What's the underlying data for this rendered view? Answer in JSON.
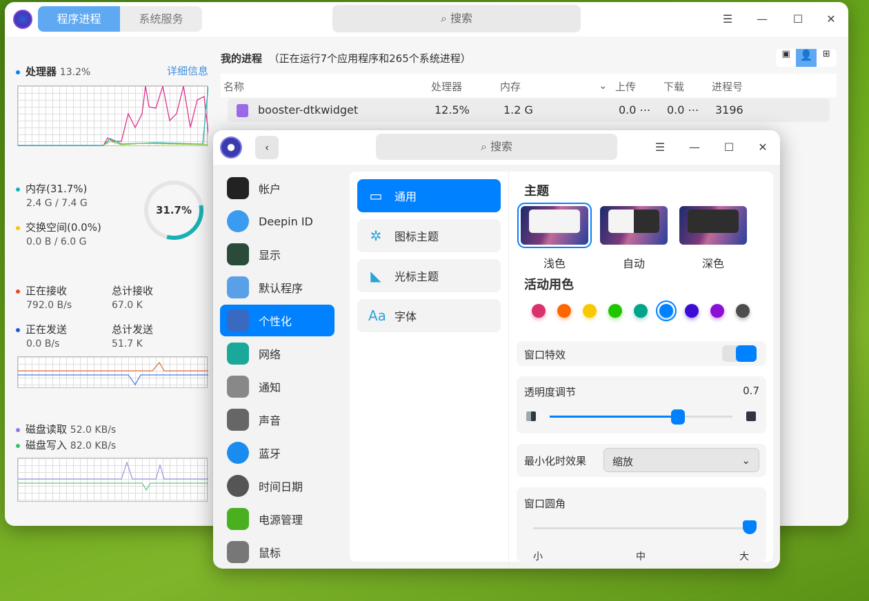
{
  "monitor": {
    "tabs": [
      "程序进程",
      "系统服务"
    ],
    "search": "搜索",
    "cpu": {
      "label": "处理器",
      "value": "13.2%",
      "detail": "详细信息"
    },
    "memory": {
      "label": "内存(31.7%)",
      "usage": "2.4 G / 7.4 G",
      "percent_text": "31.7%",
      "percent": 31.7
    },
    "swap": {
      "label": "交换空间(0.0%)",
      "usage": "0.0 B / 6.0 G"
    },
    "net": {
      "recv_label": "正在接收",
      "recv": "792.0 B/s",
      "total_recv_label": "总计接收",
      "total_recv": "67.0 K",
      "send_label": "正在发送",
      "send": "0.0 B/s",
      "total_send_label": "总计发送",
      "total_send": "51.7 K"
    },
    "disk": {
      "read_label": "磁盘读取",
      "read": "52.0 KB/s",
      "write_label": "磁盘写入",
      "write": "82.0 KB/s"
    },
    "proc_title": "我的进程",
    "proc_sub": "（正在运行7个应用程序和265个系统进程）",
    "columns": [
      "名称",
      "处理器",
      "内存",
      "上传",
      "下载",
      "进程号"
    ],
    "rows": [
      {
        "name": "booster-dtkwidget",
        "cpu": "12.5%",
        "mem": "1.2 G",
        "up": "0.0 ⋯",
        "down": "0.0 ⋯",
        "pid": "3196"
      }
    ]
  },
  "settings": {
    "search": "搜索",
    "nav": [
      "帐户",
      "Deepin ID",
      "显示",
      "默认程序",
      "个性化",
      "网络",
      "通知",
      "声音",
      "蓝牙",
      "时间日期",
      "电源管理",
      "鼠标"
    ],
    "sub": [
      "通用",
      "图标主题",
      "光标主题",
      "字体"
    ],
    "theme_title": "主题",
    "themes": [
      "浅色",
      "自动",
      "深色"
    ],
    "accent_title": "活动用色",
    "accent_colors": [
      "#d8326c",
      "#ff6600",
      "#f9c900",
      "#22c400",
      "#00a48a",
      "#0081ff",
      "#3d0ad6",
      "#8c0fd6",
      "#4d4d4d"
    ],
    "accent_selected": "#0081ff",
    "window_effect": "窗口特效",
    "window_effect_on": true,
    "opacity_label": "透明度调节",
    "opacity_value": "0.7",
    "opacity": 0.7,
    "minimize_label": "最小化时效果",
    "minimize_value": "缩放",
    "radius_label": "窗口圆角",
    "radius_ticks": [
      "小",
      "中",
      "大"
    ],
    "radius_level": "大"
  }
}
